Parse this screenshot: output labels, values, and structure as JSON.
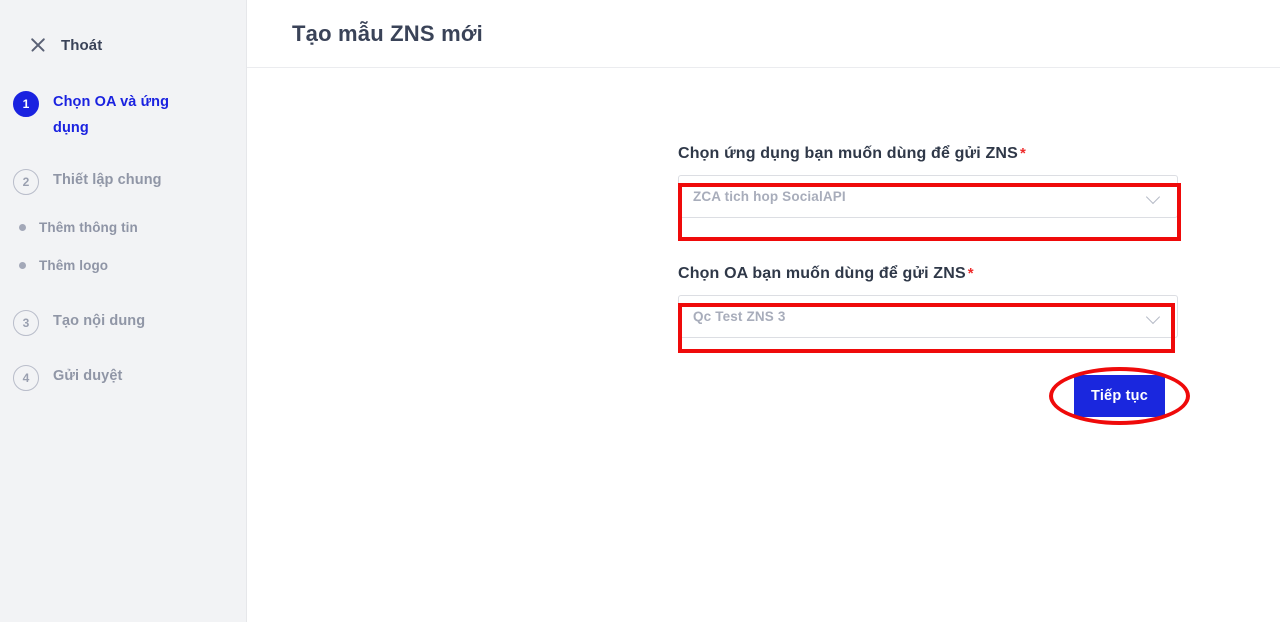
{
  "sidebar": {
    "exit": {
      "label": "Thoát",
      "icon": "close-icon"
    },
    "steps": [
      {
        "number": "1",
        "label": "Chọn OA và ứng dụng",
        "active": true
      },
      {
        "number": "2",
        "label": "Thiết lập chung",
        "active": false
      },
      {
        "number": "3",
        "label": "Tạo nội dung",
        "active": false
      },
      {
        "number": "4",
        "label": "Gửi duyệt",
        "active": false
      }
    ],
    "substeps": [
      {
        "label": "Thêm thông tin"
      },
      {
        "label": "Thêm logo"
      }
    ]
  },
  "header": {
    "title": "Tạo mẫu ZNS mới"
  },
  "form": {
    "app_field": {
      "label": "Chọn ứng dụng bạn muốn dùng để gửi ZNS",
      "required_mark": "*",
      "value": "ZCA tich hop SocialAPI",
      "chevron_icon": "chevron-down-icon"
    },
    "oa_field": {
      "label": "Chọn OA bạn muốn dùng để gửi ZNS",
      "required_mark": "*",
      "value": "Qc Test ZNS 3",
      "chevron_icon": "chevron-down-icon"
    },
    "continue_button": {
      "label": "Tiếp tục"
    }
  },
  "colors": {
    "accent_blue": "#1a27de",
    "annotation_red": "#ef0a0a",
    "sidebar_bg": "#f2f3f5",
    "muted_text": "#9096a6",
    "title_text": "#3a4358"
  }
}
